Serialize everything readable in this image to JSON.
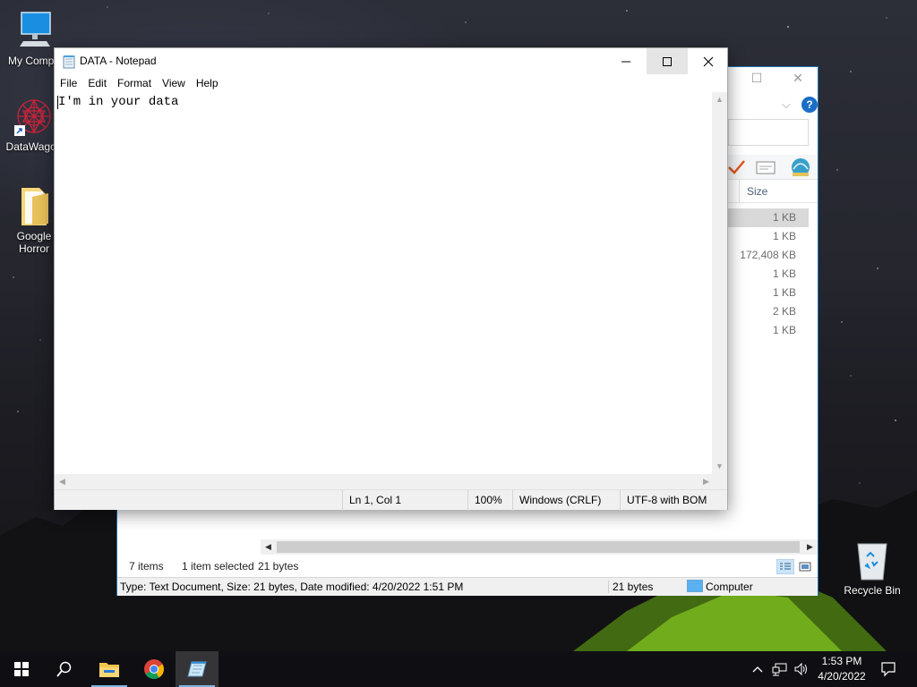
{
  "desktop": {
    "icons": [
      {
        "label": "My Compu",
        "icon": "computer-icon"
      },
      {
        "label": "DataWagon",
        "icon": "datawagon-icon"
      },
      {
        "label": "Google Horror",
        "icon": "folder-icon"
      },
      {
        "label": "Recycle Bin",
        "icon": "recycle-bin-icon"
      }
    ]
  },
  "explorer": {
    "columns": {
      "size": "Size"
    },
    "files": [
      {
        "size": "1 KB",
        "selected": true
      },
      {
        "size": "1 KB",
        "selected": false
      },
      {
        "size": "172,408 KB",
        "selected": false
      },
      {
        "size": "1 KB",
        "selected": false
      },
      {
        "size": "1 KB",
        "selected": false
      },
      {
        "size": "2 KB",
        "selected": false
      },
      {
        "size": "1 KB",
        "selected": false
      }
    ],
    "status": {
      "item_count": "7 items",
      "selection": "1 item selected",
      "selection_size": "21 bytes"
    },
    "details_bar": {
      "description": "Type: Text Document, Size: 21 bytes, Date modified: 4/20/2022 1:51 PM",
      "size": "21 bytes",
      "location": "Computer"
    }
  },
  "notepad": {
    "title": "DATA - Notepad",
    "menu": [
      "File",
      "Edit",
      "Format",
      "View",
      "Help"
    ],
    "content": "I'm in your data",
    "status": {
      "position": "Ln 1, Col 1",
      "zoom": "100%",
      "line_ending": "Windows (CRLF)",
      "encoding": "UTF-8 with BOM"
    }
  },
  "taskbar": {
    "time": "1:53 PM",
    "date": "4/20/2022",
    "accent": "#7fb3e0"
  }
}
